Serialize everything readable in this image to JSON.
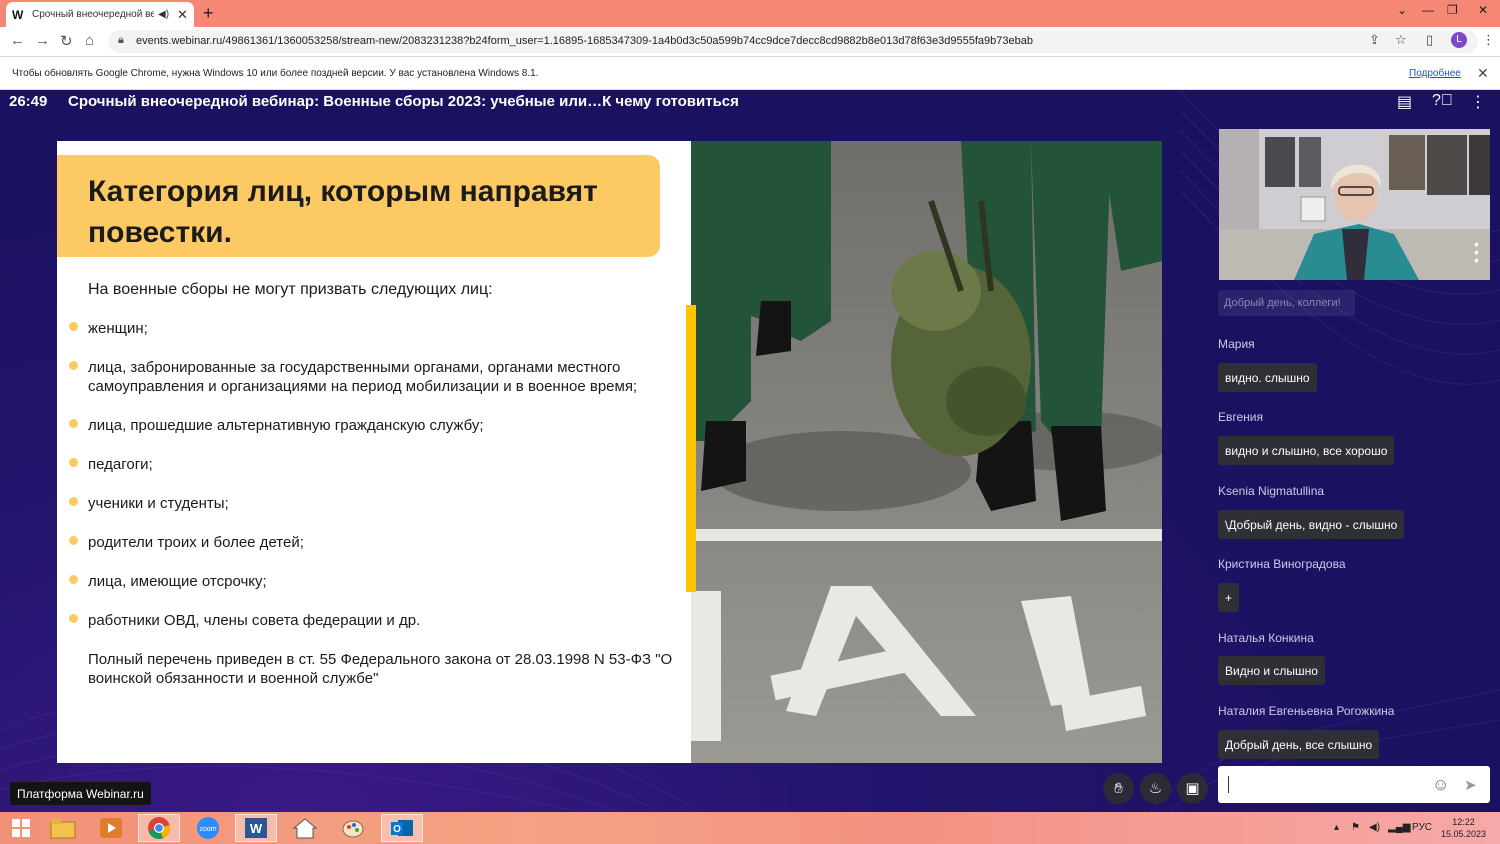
{
  "browser": {
    "tab_title": "Срочный внеочередной ве",
    "tab_favicon": "W",
    "url": "events.webinar.ru/49861361/1360053258/stream-new/2083231238?b24form_user=1.16895-1685347309-1a4b0d3c50a599b74cc9dce7decc8cd9882b8e013d78f63e3d9555fa9b73ebab",
    "profile_initial": "L",
    "infobar_text": "Чтобы обновлять Google Chrome, нужна Windows 10 или более поздней версии. У вас установлена Windows 8.1.",
    "infobar_link": "Подробнее"
  },
  "webinar": {
    "timer": "26:49",
    "title": "Срочный внеочередной вебинар: Военные сборы 2023: учебные или…К чему готовиться",
    "platform_label": "Платформа Webinar.ru"
  },
  "slide": {
    "title": "Категория лиц, которым направят повестки.",
    "intro": "На военные сборы не могут призвать следующих лиц:",
    "bullets": [
      "женщин;",
      "лица, забронированные за государственными органами, органами местного самоуправления и организациями на период мобилизации и в военное время;",
      "лица, прошедшие альтернативную гражданскую службу;",
      "педагоги;",
      "ученики и студенты;",
      "родители троих и более детей;",
      "лица, имеющие отсрочку;",
      "работники ОВД, члены совета федерации и др."
    ],
    "footnote": "Полный перечень приведен в ст. 55 Федерального закона от 28.03.1998 N 53-ФЗ \"О воинской обязанности и военной службе\""
  },
  "chat": {
    "faded_message": "Добрый день, коллеги!",
    "messages": [
      {
        "author": "Мария",
        "text": "видно. слышно"
      },
      {
        "author": "Евгения",
        "text": "видно и слышно, все хорошо"
      },
      {
        "author": "Ksenia Nigmatullina",
        "text": "\\Добрый день, видно - слышно"
      },
      {
        "author": "Кристина Виноградова",
        "text": "+"
      },
      {
        "author": "Наталья Конкина",
        "text": "Видно и слышно"
      },
      {
        "author": "Наталия Евгеньевна Рогожкина",
        "text": "Добрый день, все слышно"
      }
    ],
    "input_value": ""
  },
  "taskbar": {
    "apps": [
      "windows-start",
      "file-explorer",
      "media-player",
      "chrome",
      "zoom",
      "word",
      "home",
      "paint",
      "outlook"
    ],
    "language": "РУС",
    "time": "12:22",
    "date": "15.05.2023"
  },
  "colors": {
    "accent_yellow": "#fdc962",
    "stage_bg": "#1d1363",
    "tabstrip": "#f58774"
  }
}
